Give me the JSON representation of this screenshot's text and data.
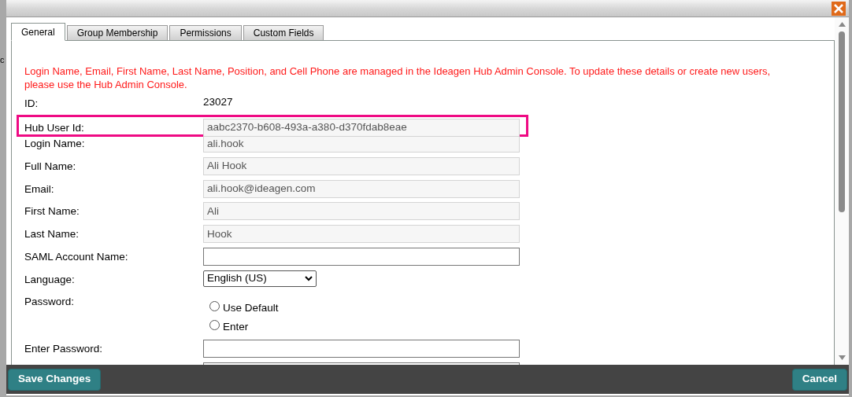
{
  "background_text": "c",
  "tabs": [
    {
      "label": "General",
      "selected": true
    },
    {
      "label": "Group Membership",
      "selected": false
    },
    {
      "label": "Permissions",
      "selected": false
    },
    {
      "label": "Custom Fields",
      "selected": false
    }
  ],
  "notice": "Login Name, Email, First Name, Last Name, Position, and Cell Phone are managed in the Ideagen Hub Admin Console. To update these details or create new users, please use the Hub Admin Console.",
  "fields": [
    {
      "kind": "text",
      "label": "ID:",
      "value": "23027",
      "highlighted": false
    },
    {
      "kind": "readonly",
      "label": "Hub User Id:",
      "value": "aabc2370-b608-493a-a380-d370fdab8eae",
      "highlighted": true
    },
    {
      "kind": "readonly",
      "label": "Login Name:",
      "value": "ali.hook",
      "highlighted": false
    },
    {
      "kind": "readonly",
      "label": "Full Name:",
      "value": "Ali Hook",
      "highlighted": false
    },
    {
      "kind": "readonly",
      "label": "Email:",
      "value": "ali.hook@ideagen.com",
      "highlighted": false
    },
    {
      "kind": "readonly",
      "label": "First Name:",
      "value": "Ali",
      "highlighted": false
    },
    {
      "kind": "readonly",
      "label": "Last Name:",
      "value": "Hook",
      "highlighted": false
    },
    {
      "kind": "input",
      "label": "SAML Account Name:",
      "highlighted": false
    },
    {
      "kind": "select",
      "label": "Language:",
      "value": "English (US)",
      "highlighted": false
    },
    {
      "kind": "radio",
      "label": "Password:",
      "options": [
        {
          "label": "Use Default",
          "selected": false
        },
        {
          "label": "Enter",
          "selected": false
        }
      ],
      "highlighted": false
    },
    {
      "kind": "input",
      "label": "Enter Password:",
      "highlighted": false
    },
    {
      "kind": "input",
      "highlighted": false
    }
  ],
  "buttons": [
    {
      "label": "Save Changes"
    },
    {
      "label": "Cancel"
    }
  ]
}
